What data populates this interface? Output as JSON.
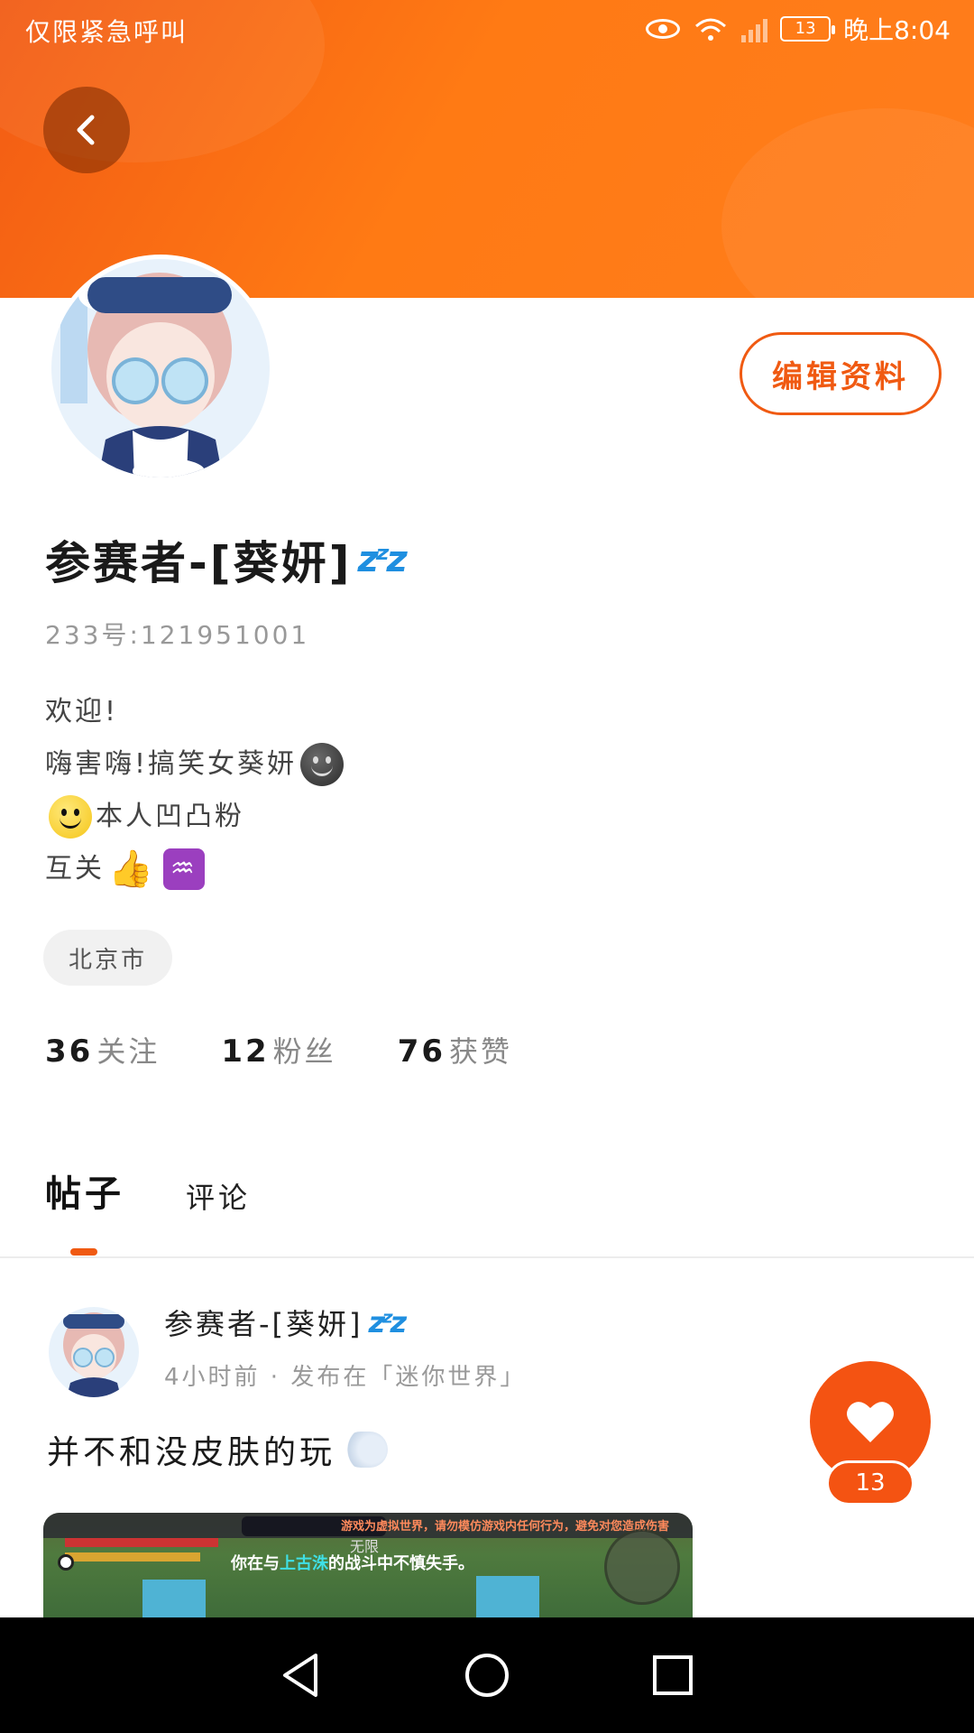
{
  "status_bar": {
    "carrier": "仅限紧急呼叫",
    "battery": "13",
    "time": "晚上8:04"
  },
  "profile": {
    "edit_label": "编辑资料",
    "username": "参赛者-[葵妍]",
    "uid": "233号:121951001",
    "bio": {
      "line1": "欢迎!",
      "line2": "嗨害嗨!搞笑女葵妍",
      "line3": "本人凹凸粉",
      "line4": "互关"
    },
    "location": "北京市"
  },
  "stats": [
    {
      "value": "36",
      "label": "关注"
    },
    {
      "value": "12",
      "label": "粉丝"
    },
    {
      "value": "76",
      "label": "获赞"
    }
  ],
  "tabs": [
    {
      "label": "帖子",
      "active": true
    },
    {
      "label": "评论",
      "active": false
    }
  ],
  "post": {
    "author": "参赛者-[葵妍]",
    "meta": "4小时前 · 发布在「迷你世界」",
    "text": "并不和没皮肤的玩",
    "image": {
      "warning": "游戏为虚拟世界，请勿模仿游戏内任何行为，避免对您造成伤害",
      "label": "无限",
      "caption_prefix": "你在与",
      "caption_highlight": "上古洙",
      "caption_suffix": "的战斗中不慎失手。"
    }
  },
  "like": {
    "count": "13"
  },
  "colors": {
    "accent": "#f05a12",
    "banner": "#ff7a14"
  }
}
